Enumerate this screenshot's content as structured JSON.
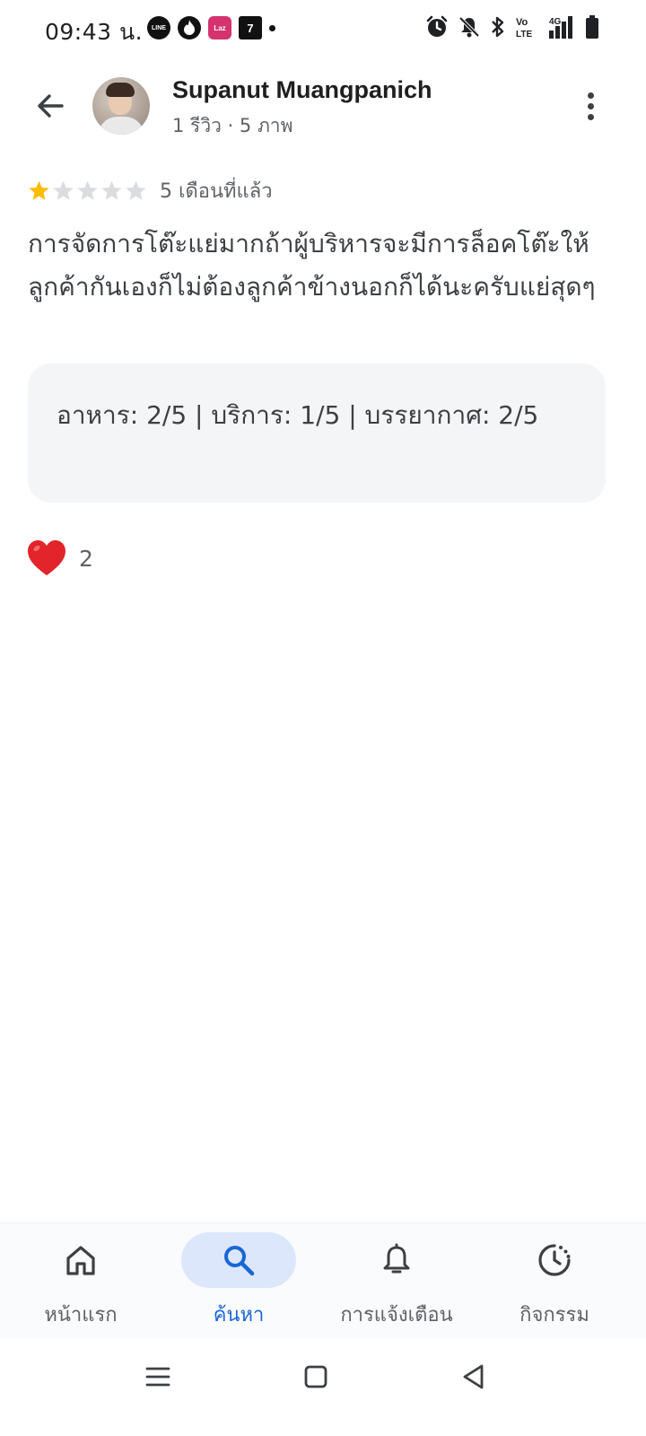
{
  "status_bar": {
    "time": "09:43 น.",
    "app_icons": [
      {
        "name": "line-app-icon",
        "label": "LINE"
      },
      {
        "name": "tinder-app-icon",
        "label": ""
      },
      {
        "name": "lazada-app-icon",
        "label": "Laz"
      },
      {
        "name": "seven-eleven-app-icon",
        "label": "7"
      }
    ],
    "signal_label": "4G",
    "volte_label": "Vo LTE"
  },
  "header": {
    "user_name": "Supanut Muangpanich",
    "user_meta": "1 รีวิว · 5 ภาพ"
  },
  "review": {
    "rating": 1,
    "max_rating": 5,
    "star_color": "#fbbc04",
    "star_empty_color": "#dadce0",
    "time_ago": "5 เดือนที่แล้ว",
    "text": "การจัดการโต๊ะแย่มากถ้าผู้บริหารจะมีการล็อคโต๊ะให้ลูกค้ากันเองก็ไม่ต้องลูกค้าข้างนอกก็ได้นะครับแย่สุดๆ",
    "sub_ratings": "อาหาร: 2/5  |  บริการ: 1/5  |  บรรยากาศ: 2/5",
    "like_count": "2"
  },
  "bottom_nav": {
    "items": [
      {
        "id": "home",
        "label": "หน้าแรก",
        "icon": "home-icon",
        "active": false
      },
      {
        "id": "search",
        "label": "ค้นหา",
        "icon": "search-icon",
        "active": true
      },
      {
        "id": "notifications",
        "label": "การแจ้งเตือน",
        "icon": "bell-icon",
        "active": false
      },
      {
        "id": "activity",
        "label": "กิจกรรม",
        "icon": "activity-icon",
        "active": false
      }
    ],
    "active_color": "#1a66d6"
  }
}
